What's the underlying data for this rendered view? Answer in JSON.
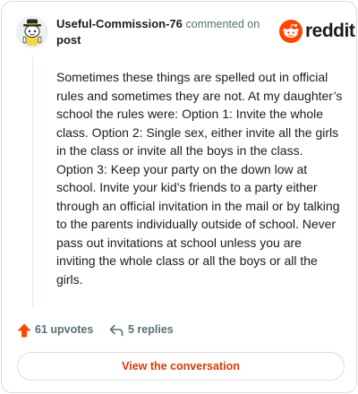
{
  "comment": {
    "username": "Useful-Commission-76",
    "action": "commented on",
    "target": "post",
    "body": "Sometimes these things are spelled out in official rules and sometimes they are not. At my daughter’s school the rules were: Option 1: Invite the whole class. Option 2: Single sex, either invite all the girls in the class or invite all the boys in the class. Option 3: Keep your party on the down low at school. Invite your kid’s friends to a party either through an official invitation in the mail or by talking to the parents individually outside of school. Never pass out invitations at school unless you are inviting the whole class or all the boys or all the girls."
  },
  "brand": {
    "wordmark": "reddit",
    "icon": "reddit-snoo-icon",
    "color": "#ff4500"
  },
  "stats": {
    "upvotes": "61 upvotes",
    "replies": "5 replies",
    "upvote_icon": "upvote-arrow-icon",
    "reply_icon": "reply-arrow-icon",
    "upvote_color": "#ff4500"
  },
  "actions": {
    "view_conversation": "View the conversation"
  }
}
